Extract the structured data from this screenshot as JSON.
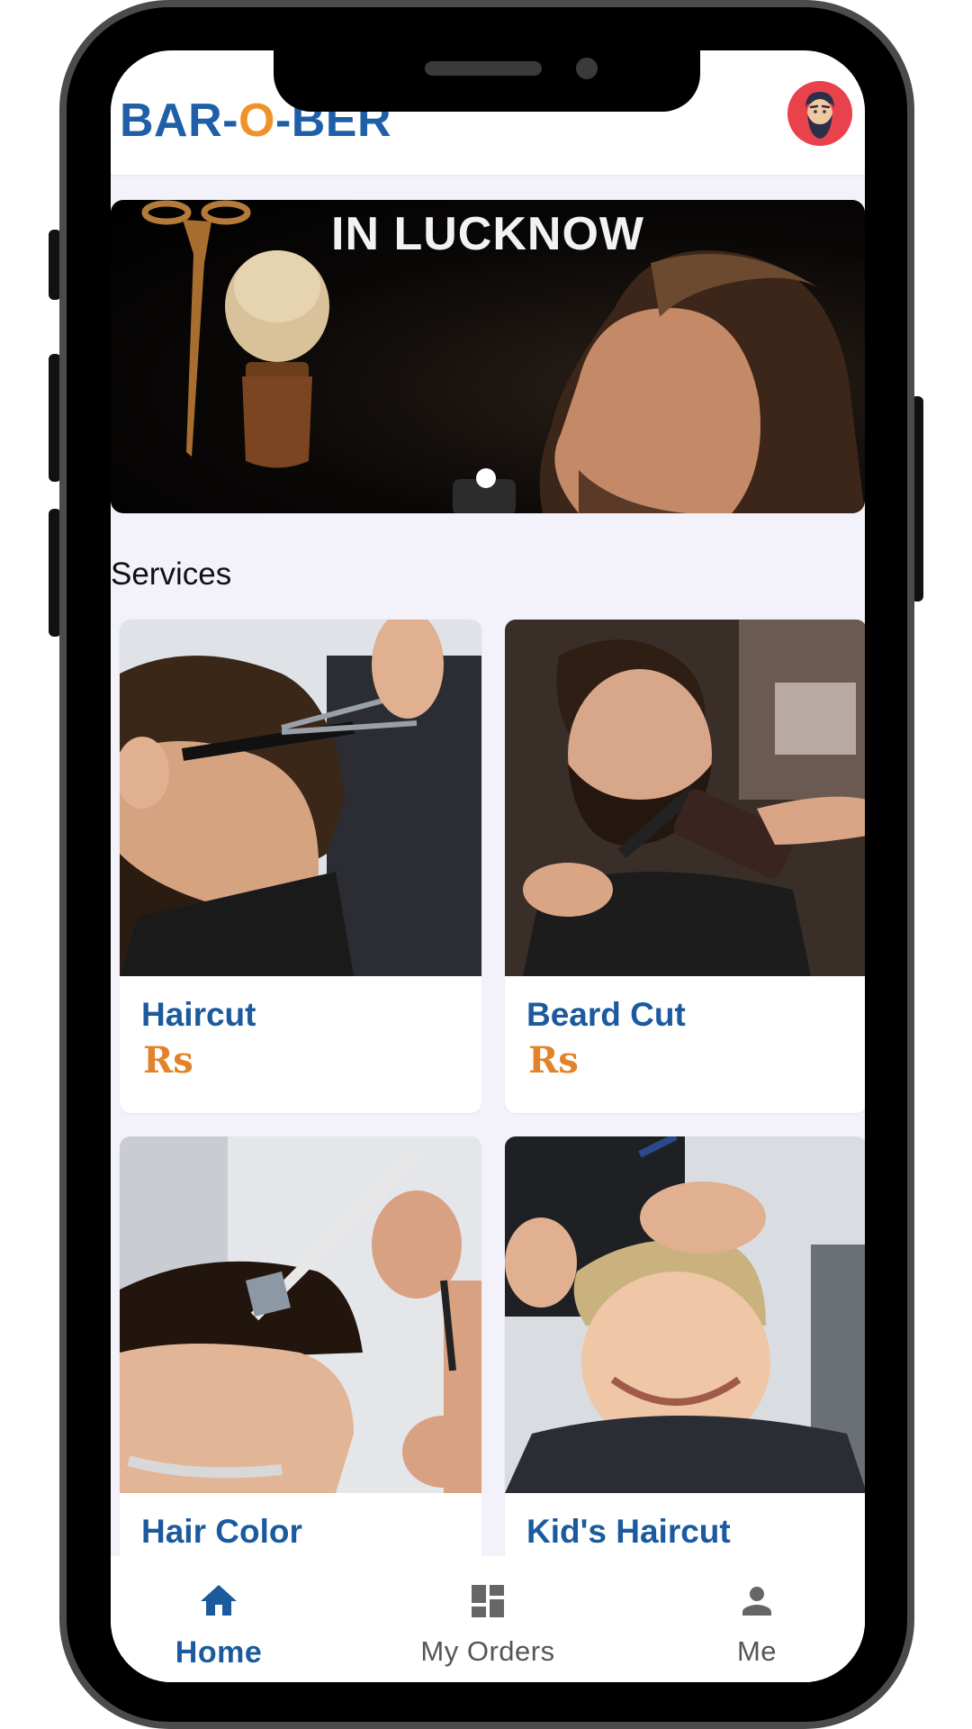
{
  "app": {
    "brand_part1": "BAR-",
    "brand_part2": "O",
    "brand_part3": "-BER",
    "brand_color": "#1f5fa8",
    "accent_color": "#f0922a"
  },
  "header": {
    "avatar_icon": "bearded-man-avatar-icon"
  },
  "banner": {
    "title": "IN LUCKNOW",
    "active_slide": 1,
    "slide_count": 1
  },
  "services": {
    "title": "Services",
    "items": [
      {
        "name": "Haircut",
        "price": "Rs"
      },
      {
        "name": "Beard Cut",
        "price": "Rs"
      },
      {
        "name": "Hair Color",
        "price": ""
      },
      {
        "name": "Kid's Haircut",
        "price": ""
      }
    ]
  },
  "bottom_nav": {
    "items": [
      {
        "label": "Home",
        "icon": "home-icon",
        "active": true
      },
      {
        "label": "My Orders",
        "icon": "dashboard-grid-icon",
        "active": false
      },
      {
        "label": "Me",
        "icon": "person-icon",
        "active": false
      }
    ],
    "active_color": "#1c5a9e"
  }
}
